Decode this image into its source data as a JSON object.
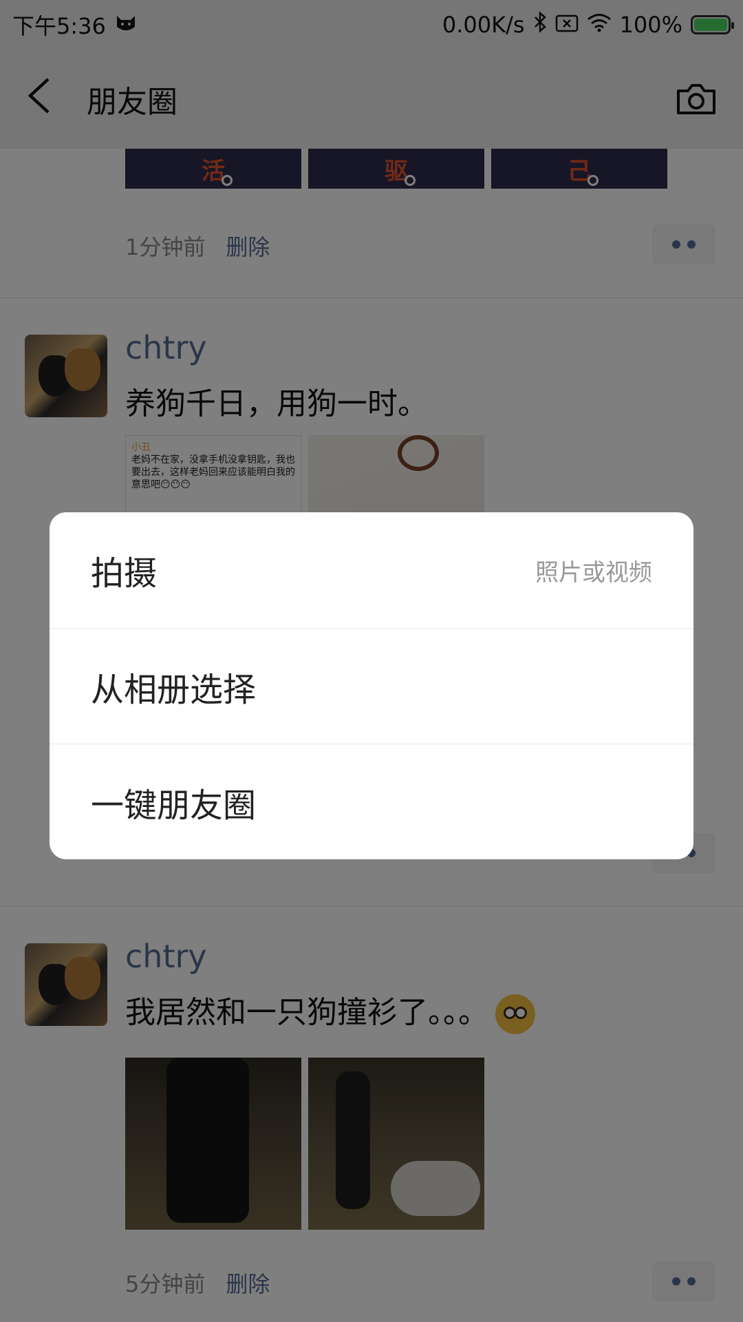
{
  "status_bar": {
    "time": "下午5:36",
    "net_speed": "0.00K/s",
    "battery": "100%",
    "icons": [
      "cat-icon",
      "bluetooth-icon",
      "no-sim-icon",
      "wifi-icon",
      "battery-icon"
    ]
  },
  "nav": {
    "back_icon": "back-arrow-icon",
    "title": "朋友圈",
    "camera_icon": "camera-icon"
  },
  "feed": {
    "top_post": {
      "thumb_chars": [
        "活",
        "驱",
        "己"
      ],
      "time": "1分钟前",
      "delete": "删除"
    },
    "post_middle": {
      "username": "chtry",
      "text": "养狗千日，用狗一时。",
      "image_caption": {
        "nick": "小丑",
        "text": "老妈不在家，没拿手机没拿钥匙，我也要出去，这样老妈回来应该能明白我的意思吧😶😶😶"
      }
    },
    "post_bottom": {
      "username": "chtry",
      "text": "我居然和一只狗撞衫了。。。",
      "emoji": "astonished-emoji",
      "time": "5分钟前",
      "delete": "删除"
    }
  },
  "action_sheet": {
    "items": [
      {
        "label": "拍摄",
        "hint": "照片或视频"
      },
      {
        "label": "从相册选择",
        "hint": ""
      },
      {
        "label": "一键朋友圈",
        "hint": ""
      }
    ]
  },
  "colors": {
    "link": "#576b95",
    "overlay": "rgba(0,0,0,0.5)"
  }
}
